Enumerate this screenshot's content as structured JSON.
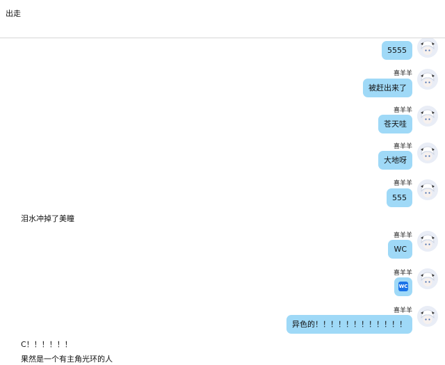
{
  "window": {
    "title": "出走"
  },
  "messages": {
    "m1": {
      "text": "5555"
    },
    "m2": {
      "sender": "喜羊羊",
      "text": "被赶出来了"
    },
    "m3": {
      "sender": "喜羊羊",
      "text": "苍天哇"
    },
    "m4": {
      "sender": "喜羊羊",
      "text": "大地呀"
    },
    "m5": {
      "sender": "喜羊羊",
      "text": "555"
    },
    "s1": {
      "text": "泪水冲掉了美瞳"
    },
    "m6": {
      "sender": "喜羊羊",
      "text": "WC"
    },
    "m7": {
      "sender": "喜羊羊",
      "emoji_text": "WC",
      "emoji_icon": "wc-emoji-icon"
    },
    "m8": {
      "sender": "喜羊羊",
      "text": "异色的！！！！！！！！！！！！"
    },
    "s2": {
      "text": "C！！！！！！"
    },
    "s3": {
      "text": "果然是一个有主角光环的人"
    }
  },
  "colors": {
    "bubble": "#9fd9f7",
    "header_border": "#d6d6d6",
    "emoji_bg": "#1a73e8"
  }
}
